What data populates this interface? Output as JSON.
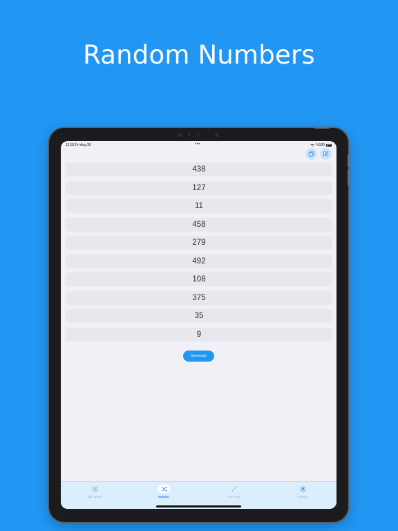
{
  "headline": "Random Numbers",
  "status_bar": {
    "time_date": "12:31  Fri Aug 30",
    "dots": "•••",
    "battery": "%100"
  },
  "top_actions": [
    {
      "icon": "copy-icon"
    },
    {
      "icon": "edit-icon"
    }
  ],
  "numbers": [
    "438",
    "127",
    "11",
    "458",
    "279",
    "492",
    "108",
    "375",
    "35",
    "9"
  ],
  "generate_label": "Generate",
  "tabs": [
    {
      "label": "Spin Wheel",
      "icon": "wheel-icon",
      "active": false
    },
    {
      "label": "Number",
      "icon": "shuffle-icon",
      "active": true
    },
    {
      "label": "Coin Toss",
      "icon": "coin-icon",
      "active": false
    },
    {
      "label": "Settings",
      "icon": "gear-icon",
      "active": false
    }
  ],
  "colors": {
    "background": "#2196F3",
    "accent": "#1e88e5",
    "screen": "#f1f0f6",
    "row": "#e8e7ee",
    "tab_bar": "#dceefc"
  }
}
